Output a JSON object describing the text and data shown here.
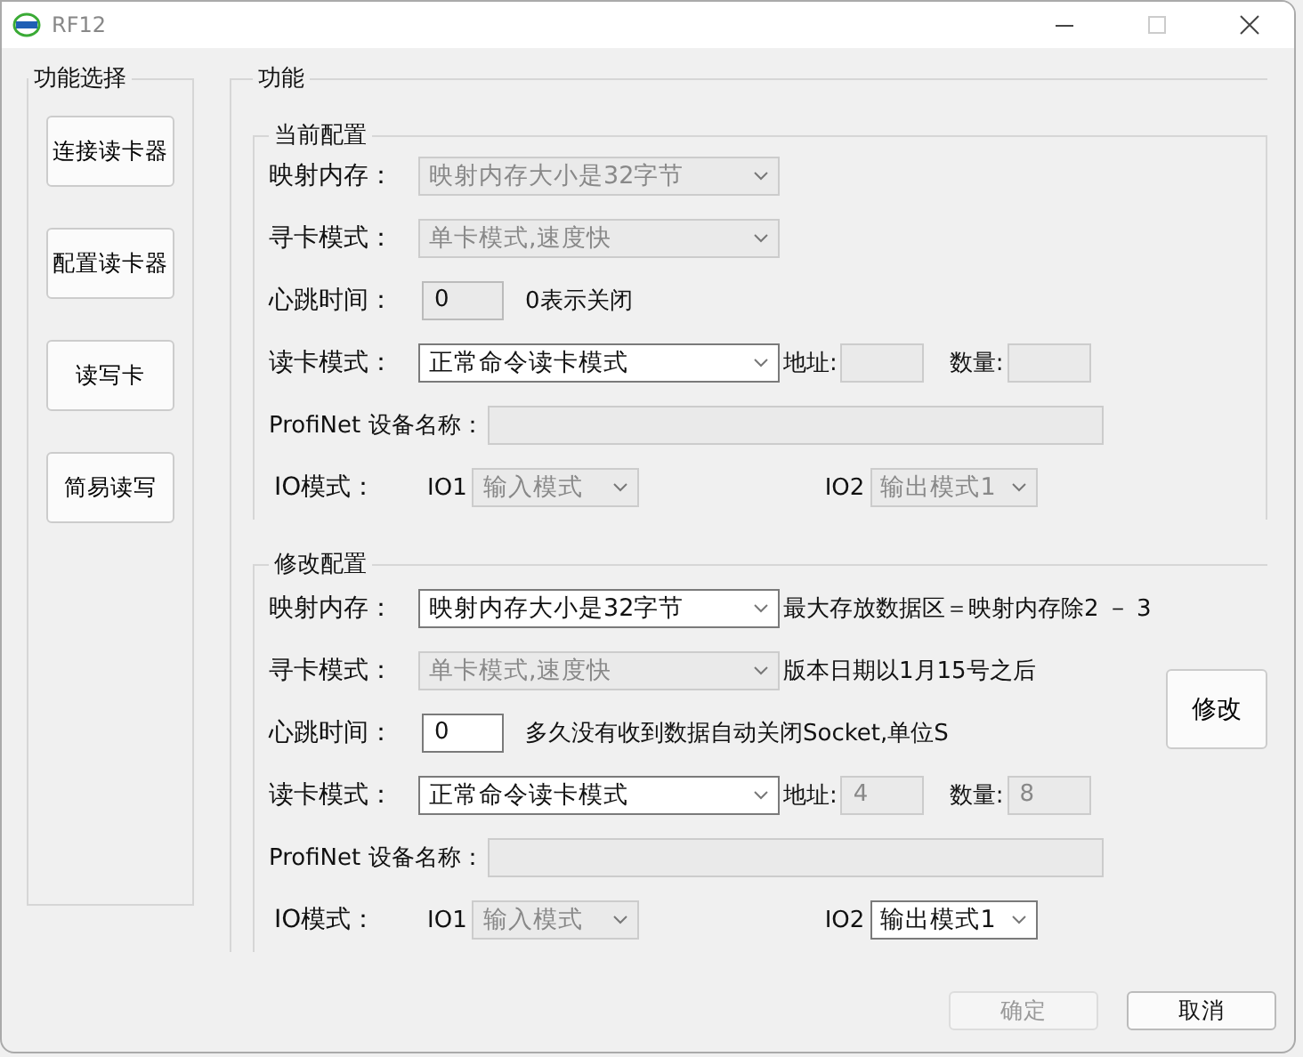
{
  "window": {
    "title": "RF12"
  },
  "sidebar": {
    "title": "功能选择",
    "buttons": [
      "连接读卡器",
      "配置读卡器",
      "读写卡",
      "简易读写"
    ]
  },
  "panel": {
    "title": "功能",
    "groups": [
      {
        "title": "当前配置",
        "mapping": {
          "label": "映射内存：",
          "value": "映射内存大小是32字节",
          "disabled": true
        },
        "search_mode": {
          "label": "寻卡模式：",
          "value": "单卡模式,速度快",
          "disabled": true
        },
        "heartbeat": {
          "label": "心跳时间：",
          "value": "0",
          "readonly": true,
          "note": "0表示关闭"
        },
        "read_mode": {
          "label": "读卡模式：",
          "value": "正常命令读卡模式",
          "disabled": false
        },
        "address": {
          "label": "地址:",
          "disabled": true
        },
        "count": {
          "label": "数量:",
          "disabled": true
        },
        "profinet": {
          "label": "ProfiNet 设备名称："
        },
        "io": {
          "label": "IO模式：",
          "io1": {
            "label": "IO1",
            "value": "输入模式",
            "disabled": true
          },
          "io2": {
            "label": "IO2",
            "value": "输出模式1",
            "disabled": true
          }
        }
      },
      {
        "title": "修改配置",
        "mapping": {
          "label": "映射内存：",
          "value": "映射内存大小是32字节",
          "disabled": false,
          "note": "最大存放数据区＝映射内存除2 － 3"
        },
        "search_mode": {
          "label": "寻卡模式：",
          "value": "单卡模式,速度快",
          "disabled": true,
          "note": "版本日期以1月15号之后"
        },
        "heartbeat": {
          "label": "心跳时间：",
          "value": "0",
          "readonly": false,
          "note": "多久没有收到数据自动关闭Socket,单位S"
        },
        "read_mode": {
          "label": "读卡模式：",
          "value": "正常命令读卡模式",
          "disabled": false
        },
        "address": {
          "label": "地址:",
          "value": "4",
          "disabled": true
        },
        "count": {
          "label": "数量:",
          "value": "8",
          "disabled": true
        },
        "profinet": {
          "label": "ProfiNet 设备名称："
        },
        "io": {
          "label": "IO模式：",
          "io1": {
            "label": "IO1",
            "value": "输入模式",
            "disabled": true
          },
          "io2": {
            "label": "IO2",
            "value": "输出模式1",
            "disabled": false
          }
        },
        "button": "修改"
      }
    ]
  },
  "footer": [
    {
      "label": "确定",
      "disabled": true
    },
    {
      "label": "取消",
      "disabled": false
    }
  ]
}
